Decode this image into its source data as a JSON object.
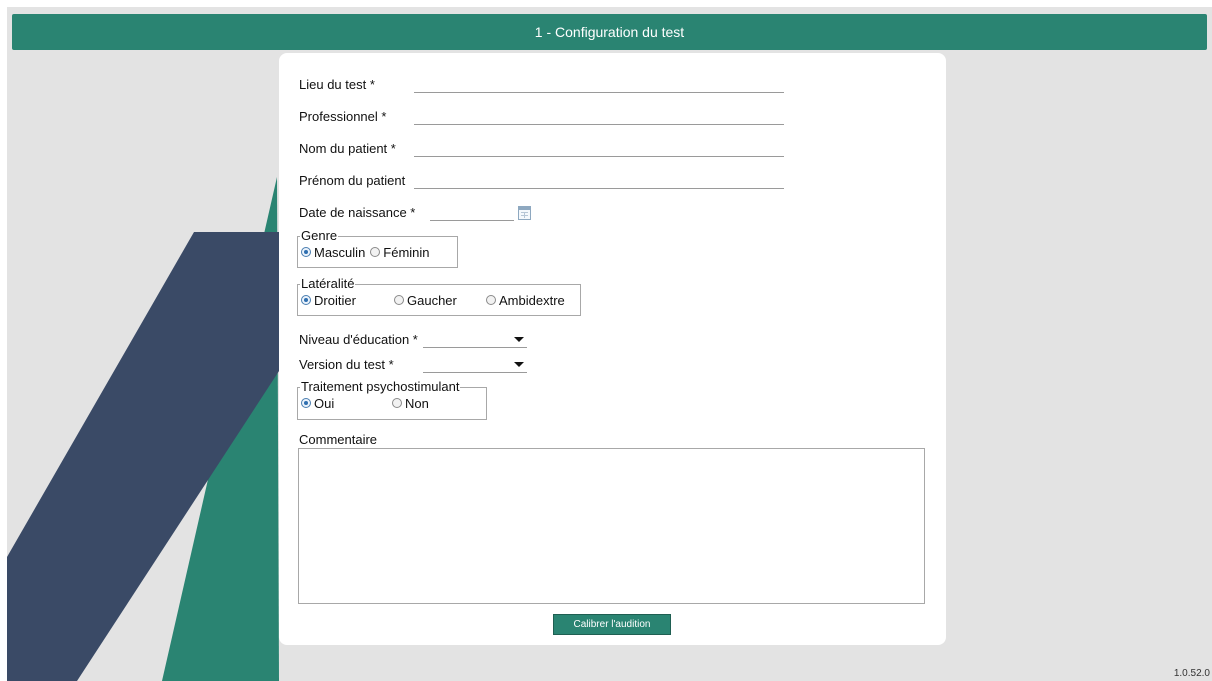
{
  "header": {
    "title": "1 - Configuration du test"
  },
  "form": {
    "lieu": {
      "label": "Lieu du test *",
      "value": ""
    },
    "professionnel": {
      "label": "Professionnel *",
      "value": ""
    },
    "nom": {
      "label": "Nom du patient *",
      "value": ""
    },
    "prenom": {
      "label": "Prénom du patient",
      "value": ""
    },
    "naissance": {
      "label": "Date de naissance *",
      "value": "",
      "icon": "calendar-icon"
    },
    "genre": {
      "legend": "Genre",
      "options": [
        "Masculin",
        "Féminin"
      ],
      "selected": "Masculin"
    },
    "lateralite": {
      "legend": "Latéralité",
      "options": [
        "Droitier",
        "Gaucher",
        "Ambidextre"
      ],
      "selected": "Droitier"
    },
    "education": {
      "label": "Niveau d'éducation *",
      "value": ""
    },
    "version_test": {
      "label": "Version du test *",
      "value": ""
    },
    "traitement": {
      "legend": "Traitement psychostimulant",
      "options": [
        "Oui",
        "Non"
      ],
      "selected": "Oui"
    },
    "commentaire": {
      "label": "Commentaire",
      "value": ""
    }
  },
  "actions": {
    "calibrate_label": "Calibrer l'audition"
  },
  "footer": {
    "version": "1.0.52.0"
  },
  "theme": {
    "accent": "#2a8472",
    "navy": "#3a4a66",
    "background": "#e3e3e3"
  }
}
